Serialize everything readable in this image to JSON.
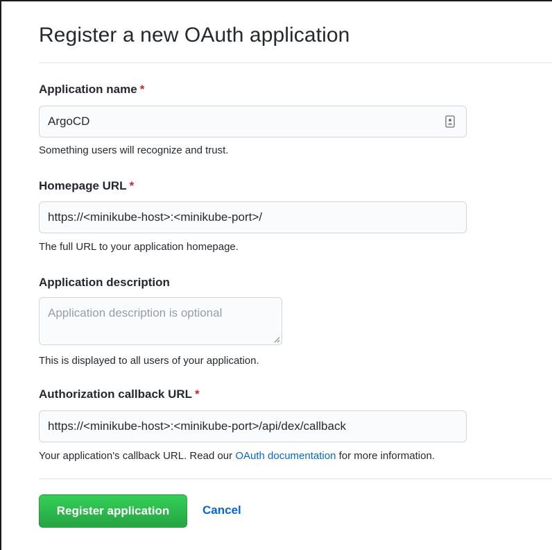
{
  "page": {
    "title": "Register a new OAuth application"
  },
  "form": {
    "app_name": {
      "label": "Application name",
      "required_mark": "*",
      "value": "ArgoCD",
      "hint": "Something users will recognize and trust."
    },
    "homepage_url": {
      "label": "Homepage URL",
      "required_mark": "*",
      "value": "https://<minikube-host>:<minikube-port>/",
      "hint": "The full URL to your application homepage."
    },
    "description": {
      "label": "Application description",
      "placeholder": "Application description is optional",
      "hint": "This is displayed to all users of your application."
    },
    "callback_url": {
      "label": "Authorization callback URL",
      "required_mark": "*",
      "value": "https://<minikube-host>:<minikube-port>/api/dex/callback",
      "hint_before": "Your application's callback URL. Read our ",
      "hint_link": "OAuth documentation",
      "hint_after": " for more information."
    }
  },
  "actions": {
    "register_label": "Register application",
    "cancel_label": "Cancel"
  },
  "colors": {
    "primary_button": "#2ea44f",
    "link": "#0366d6",
    "required": "#cb2431"
  },
  "icons": {
    "autofill": "contact-card-icon",
    "resize": "resize-handle-icon"
  }
}
